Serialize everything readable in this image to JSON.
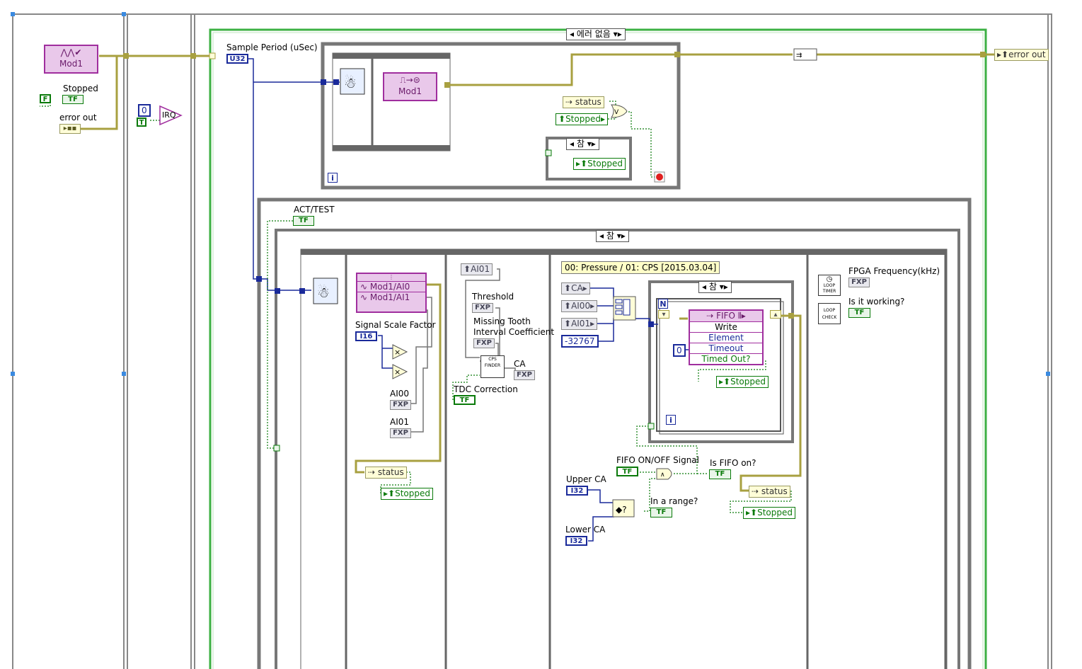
{
  "case_selectors": {
    "error_case": "에러 없음",
    "stop_case": "참",
    "act_case": "참",
    "fifo_case": "참"
  },
  "io_nodes": {
    "mod1_top": "Mod1",
    "mod1_wait": "Mod1",
    "ai0": "Mod1/AI0",
    "ai1": "Mod1/AI1",
    "fifo": "FIFO",
    "fifo_rows": [
      "Write",
      "Element",
      "Timeout",
      "Timed Out?"
    ]
  },
  "labels": {
    "stopped": "Stopped",
    "error_out": "error out",
    "sample_period": "Sample Period (uSec)",
    "act_test": "ACT/TEST",
    "signal_scale_factor": "Signal Scale Factor",
    "ai00": "AI00",
    "ai01": "AI01",
    "threshold": "Threshold",
    "missing_tooth": "Missing Tooth",
    "interval_coefficient": "Interval Coefficient",
    "ca": "CA",
    "tdc_correction": "TDC Correction",
    "fpga_frequency": "FPGA Frequency(kHz)",
    "is_it_working": "Is it working?",
    "fifo_on_off": "FIFO ON/OFF Signal",
    "is_fifo_on": "Is FIFO on?",
    "upper_ca": "Upper CA",
    "lower_ca": "Lower CA",
    "in_a_range": "In a range?"
  },
  "locals": {
    "status": "status",
    "stopped": "Stopped",
    "error_out": "error out",
    "ca": "CA",
    "ai00": "AI00",
    "ai01": "AI01"
  },
  "terminals": {
    "tf": "TF",
    "fxp": "FXP",
    "u32": "U32",
    "i16": "I16",
    "i32": "I32",
    "f_const": "F",
    "t_const": "T",
    "n": "N",
    "i": "i",
    "irq": "IRQ"
  },
  "constants": {
    "irq_zero": "0",
    "timeout_zero": "0",
    "neg_value": "-32767"
  },
  "comment": "00: Pressure / 01: CPS [2015.03.04]",
  "icon_text": {
    "loop_timer": "LOOP TIMER",
    "loop_check": "LOOP CHECK",
    "cps_finder": "CPS FINDER"
  },
  "colors": {
    "error_cluster_wire": "#a8a040",
    "int_wire": "#1a2a9a",
    "bool_wire": "#0a7a0a",
    "fpga_io": "#a02e9e",
    "structure": "#777777"
  }
}
